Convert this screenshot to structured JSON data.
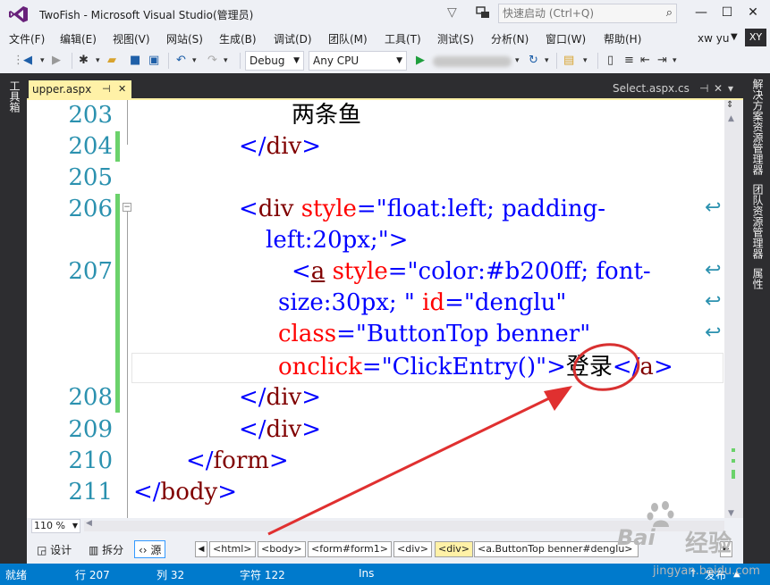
{
  "window": {
    "title": "TwoFish - Microsoft Visual Studio(管理员)",
    "quick_launch_placeholder": "快速启动 (Ctrl+Q)",
    "minimize": "—",
    "maximize": "☐",
    "close": "✕"
  },
  "menu": {
    "items": [
      "文件(F)",
      "编辑(E)",
      "视图(V)",
      "网站(S)",
      "生成(B)",
      "调试(D)",
      "团队(M)",
      "工具(T)",
      "测试(S)",
      "分析(N)",
      "窗口(W)",
      "帮助(H)"
    ],
    "user_name": "xw yu",
    "avatar_initials": "XY"
  },
  "toolbar": {
    "config": "Debug",
    "platform": "Any CPU"
  },
  "left_dock": {
    "toolbox": "工具箱"
  },
  "right_dock": {
    "tabs": [
      "解决方案资源管理器",
      "团队资源管理器",
      "属性"
    ]
  },
  "tabs": {
    "active": {
      "label": "upper.aspx",
      "pin": "⊣",
      "close": "✕"
    },
    "preview": {
      "label": "Select.aspx.cs"
    }
  },
  "editor": {
    "line_numbers": [
      "203",
      "204",
      "205",
      "206",
      "207",
      "208",
      "209",
      "210",
      "211"
    ],
    "lines": {
      "l203_text": "两条鱼",
      "l204_close": "</",
      "l204_el": "div",
      "l204_end": ">",
      "l206_open": "<",
      "l206_el": "div",
      "l206_attr": " style",
      "l206_eq": "=\"",
      "l206_val": "float:left; padding-",
      "l206b_val": "left:20px;",
      "l206b_end": "\">",
      "l207_open": "<",
      "l207_el": "a",
      "l207_attr": " style",
      "l207_eq": "=\"",
      "l207_val": "color:#b200ff; font-",
      "l207b_val": "size:30px; ",
      "l207b_q": "\"",
      "l207b_attr": " id",
      "l207b_eq": "=\"",
      "l207b_val2": "denglu",
      "l207b_q2": "\"",
      "l207c_attr": "class",
      "l207c_eq": "=\"",
      "l207c_val": "ButtonTop benner",
      "l207c_q": "\"",
      "l207d_attr": "onclick",
      "l207d_eq": "=\"",
      "l207d_val": "ClickEntry()",
      "l207d_q": "\"",
      "l207d_gt": ">",
      "l207d_text": "登录",
      "l207d_close": "</",
      "l207d_el": "a",
      "l207d_end": ">",
      "l208_close": "</",
      "l208_el": "div",
      "l208_end": ">",
      "l209_close": "</",
      "l209_el": "div",
      "l209_end": ">",
      "l210_close": "</",
      "l210_el": "form",
      "l210_end": ">",
      "l211_close": "</",
      "l211_el": "body",
      "l211_end": ">"
    }
  },
  "zoom": "110 %",
  "view_buttons": {
    "design": "设计",
    "split": "拆分",
    "source": "源"
  },
  "breadcrumbs": [
    "<html>",
    "<body>",
    "<form#form1>",
    "<div>",
    "<div>",
    "<a.ButtonTop benner#denglu>"
  ],
  "status": {
    "ready": "就绪",
    "line": "行 207",
    "col": "列 32",
    "char": "字符 122",
    "mode": "Ins",
    "publish": "发布"
  },
  "watermark": {
    "brand": "Bai",
    "brand2": "经验",
    "url": "jingyan.baidu.com"
  },
  "colors": {
    "accent": "#007acc",
    "dock": "#2d2d30",
    "active_tab": "#fff1a7",
    "tag": "#800000",
    "attr": "#ff0000",
    "value": "#0000ff",
    "line_number": "#2b91af",
    "change_bar": "#6bd26b",
    "annotation": "#e03030"
  }
}
